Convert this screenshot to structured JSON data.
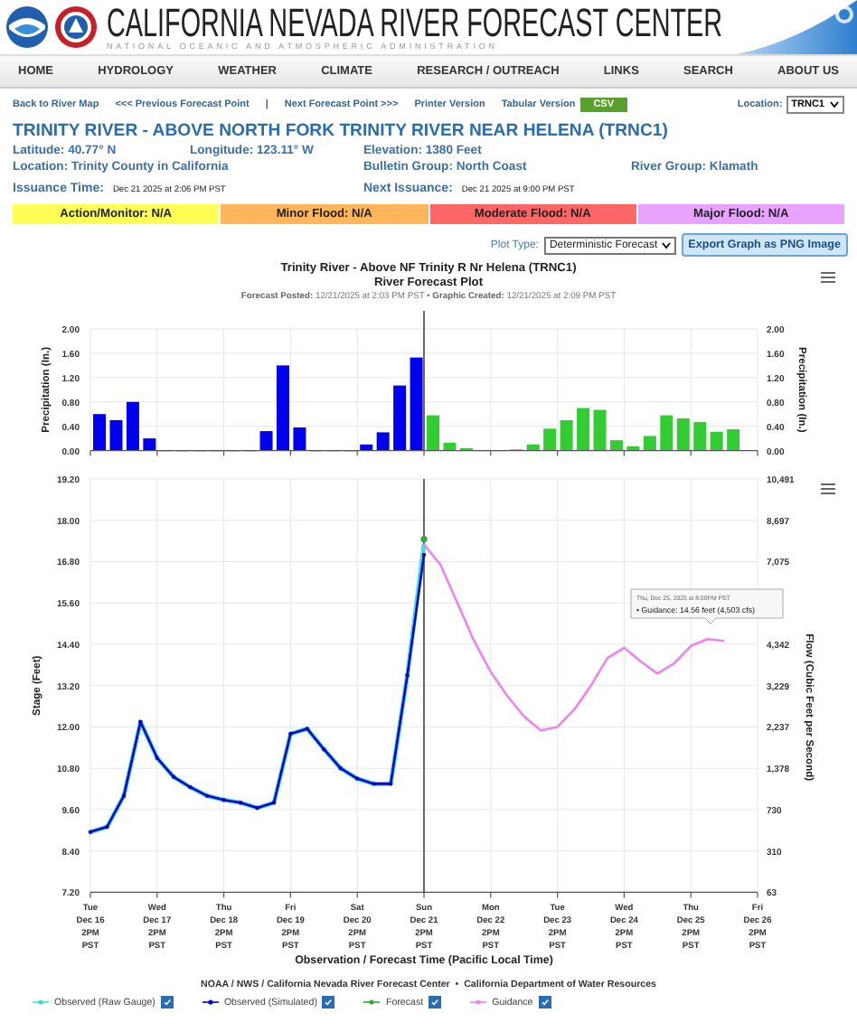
{
  "header": {
    "title": "CALIFORNIA NEVADA RIVER FORECAST CENTER",
    "subtitle": "NATIONAL OCEANIC AND ATMOSPHERIC ADMINISTRATION"
  },
  "nav": [
    "HOME",
    "HYDROLOGY",
    "WEATHER",
    "CLIMATE",
    "RESEARCH / OUTREACH",
    "LINKS",
    "SEARCH",
    "ABOUT US"
  ],
  "links": [
    "Back to River Map",
    "<<< Previous Forecast Point",
    "|",
    "Next Forecast Point >>>",
    "Printer Version",
    "Tabular Version"
  ],
  "csv_button": "CSV",
  "location": {
    "label": "Location:",
    "value": "TRNC1"
  },
  "station": {
    "title": "TRINITY RIVER - ABOVE NORTH FORK TRINITY RIVER NEAR HELENA (TRNC1)",
    "rows": [
      [
        "Latitude: 40.77° N",
        "Longitude: 123.11° W",
        "Elevation: 1380 Feet",
        null
      ],
      [
        "Location: Trinity County in California",
        null,
        "Bulletin Group: North Coast",
        "River Group: Klamath"
      ]
    ],
    "issuance": [
      {
        "label": "Issuance Time:",
        "value": "Dec 21 2025 at 2:06 PM PST"
      },
      {
        "label": "Next Issuance:",
        "value": "Dec 21 2025 at 9:00 PM PST"
      }
    ]
  },
  "flood_levels": [
    {
      "label": "Action/Monitor: N/A",
      "color": "#ffff55"
    },
    {
      "label": "Minor Flood: N/A",
      "color": "#ffb55a"
    },
    {
      "label": "Moderate Flood: N/A",
      "color": "#ff6666"
    },
    {
      "label": "Major Flood: N/A",
      "color": "#e7a3ff"
    }
  ],
  "plot_controls": {
    "label": "Plot Type:",
    "select": "Deterministic Forecast",
    "button": "Export Graph as PNG Image"
  },
  "chart": {
    "title": "Trinity River - Above NF Trinity R Nr Helena (TRNC1)",
    "subtitle": "River Forecast Plot",
    "info": "**Forecast Posted:** 12/21/2025 at 2:03 PM PST • **Graphic Created:** 12/21/2025 at 2:09 PM PST"
  },
  "precipitation": {
    "chart_data": {
      "type": "bar",
      "ylabel": "Precipitation (In.)",
      "ylim": [
        0,
        2
      ],
      "grid": true,
      "yticks": [
        {
          "value": 0,
          "label": "0.00"
        },
        {
          "value": 0.4,
          "label": "0.40"
        },
        {
          "value": 0.8,
          "label": "0.80"
        },
        {
          "value": 1.2,
          "label": "1.20"
        },
        {
          "value": 1.6,
          "label": "1.60"
        },
        {
          "value": 2,
          "label": "2.00"
        }
      ],
      "series": [
        {
          "color": "#0000ee",
          "values": [
            0.6,
            0.5,
            0.8,
            0.2,
            0,
            0,
            0,
            0,
            0,
            0,
            0.32,
            1.4,
            0.38,
            0,
            0,
            0,
            0.1,
            0.3,
            1.07,
            1.53,
            null,
            null,
            null,
            null,
            null,
            null,
            null,
            null,
            null,
            null,
            null,
            null,
            null,
            null,
            null,
            null,
            null,
            null,
            null,
            null
          ]
        },
        {
          "color": "#33cc33",
          "values": [
            null,
            null,
            null,
            null,
            null,
            null,
            null,
            null,
            null,
            null,
            null,
            null,
            null,
            null,
            null,
            null,
            null,
            null,
            null,
            null,
            0.58,
            0.13,
            0.04,
            0,
            0,
            0.02,
            0.1,
            0.36,
            0.5,
            0.7,
            0.67,
            0.17,
            0.07,
            0.24,
            0.58,
            0.53,
            0.47,
            0.31,
            0.35,
            null
          ]
        }
      ]
    },
    "right_axis": {
      "label": "Precipitation (In.)",
      "ticks": [
        "2.00",
        "1.60",
        "1.20",
        "0.80",
        "0.40",
        "0.00"
      ]
    }
  },
  "stage": {
    "chart_data": {
      "type": "line",
      "xlabel": "Observation / Forecast Time (Pacific Local Time)",
      "ylabel": "Stage (Feet)",
      "ylim": [
        7.2,
        19.2
      ],
      "grid": true,
      "yticks": [
        {
          "value": 7.2,
          "label": "7.20"
        },
        {
          "value": 8.4,
          "label": "8.40"
        },
        {
          "value": 9.6,
          "label": "9.60"
        },
        {
          "value": 10.8,
          "label": "10.80"
        },
        {
          "value": 12,
          "label": "12.00"
        },
        {
          "value": 13.2,
          "label": "13.20"
        },
        {
          "value": 14.4,
          "label": "14.40"
        },
        {
          "value": 15.6,
          "label": "15.60"
        },
        {
          "value": 16.8,
          "label": "16.80"
        },
        {
          "value": 18,
          "label": "18.00"
        },
        {
          "value": 19.2,
          "label": "19.20"
        }
      ],
      "categories": [
        "Tue\nDec 16\n2PM\nPST",
        null,
        null,
        null,
        "Wed\nDec 17\n2PM\nPST",
        null,
        null,
        null,
        "Thu\nDec 18\n2PM\nPST",
        null,
        null,
        null,
        "Fri\nDec 19\n2PM\nPST",
        null,
        null,
        null,
        "Sat\nDec 20\n2PM\nPST",
        null,
        null,
        null,
        "Sun\nDec 21\n2PM\nPST",
        null,
        null,
        null,
        "Mon\nDec 22\n2PM\nPST",
        null,
        null,
        null,
        "Tue\nDec 23\n2PM\nPST",
        null,
        null,
        null,
        "Wed\nDec 24\n2PM\nPST",
        null,
        null,
        null,
        "Thu\nDec 25\n2PM\nPST",
        null,
        null,
        null,
        "Fri\nDec 26\n2PM\nPST"
      ],
      "series": [
        {
          "name": "Observed (Raw Gauge)",
          "color": "#40e0d0",
          "values": [
            8.95,
            9.1,
            10.0,
            12.15,
            11.1,
            10.55,
            10.25,
            10.0,
            9.88,
            9.8,
            9.65,
            9.8,
            11.8,
            11.95,
            11.35,
            10.8,
            10.5,
            10.35,
            10.35,
            13.5,
            17.3,
            null,
            null,
            null,
            null,
            null,
            null,
            null,
            null,
            null,
            null,
            null,
            null,
            null,
            null,
            null,
            null,
            null,
            null,
            null,
            null
          ]
        },
        {
          "name": "Observed (Simulated)",
          "color": "#0000cc",
          "marker": true,
          "values": [
            8.95,
            9.1,
            10.0,
            12.15,
            11.1,
            10.55,
            10.25,
            10.0,
            9.88,
            9.8,
            9.65,
            9.8,
            11.8,
            11.95,
            11.35,
            10.8,
            10.5,
            10.35,
            10.35,
            13.5,
            17.0,
            null,
            null,
            null,
            null,
            null,
            null,
            null,
            null,
            null,
            null,
            null,
            null,
            null,
            null,
            null,
            null,
            null,
            null,
            null,
            null
          ]
        },
        {
          "name": "Forecast",
          "color": "#33aa33",
          "marker": true,
          "values": [
            null,
            null,
            null,
            null,
            null,
            null,
            null,
            null,
            null,
            null,
            null,
            null,
            null,
            null,
            null,
            null,
            null,
            null,
            null,
            null,
            17.45,
            null,
            null,
            null,
            null,
            null,
            null,
            null,
            null,
            null,
            null,
            null,
            null,
            null,
            null,
            null,
            null,
            null,
            null,
            null,
            null
          ]
        },
        {
          "name": "Guidance",
          "color": "#ee82ee",
          "values": [
            null,
            null,
            null,
            null,
            null,
            null,
            null,
            null,
            null,
            null,
            null,
            null,
            null,
            null,
            null,
            null,
            null,
            null,
            null,
            null,
            17.3,
            16.7,
            15.6,
            14.5,
            13.6,
            12.9,
            12.3,
            11.9,
            12.0,
            12.5,
            13.2,
            14.0,
            14.3,
            13.9,
            13.55,
            13.85,
            14.35,
            14.55,
            14.5,
            null,
            null
          ]
        }
      ]
    },
    "right_axis": {
      "label": "Flow (Cubic Feet per Second)",
      "tick_groups": [
        [
          "10,491",
          "8,697",
          "7,075"
        ],
        [
          "4,342",
          "3,229",
          "2,237",
          "1,378",
          "730",
          "310",
          "63"
        ]
      ]
    },
    "tooltip": {
      "title": "Thu, Dec 25, 2025 at 8:00PM PST",
      "text": "• Guidance: 14.56 feet (4,503 cfs)"
    }
  },
  "credits": "NOAA / NWS / California Nevada River Forecast Center  •  California Department of Water Resources",
  "legend": [
    {
      "checked": true
    },
    {
      "checked": true
    },
    {
      "checked": true
    },
    {
      "checked": true
    }
  ]
}
